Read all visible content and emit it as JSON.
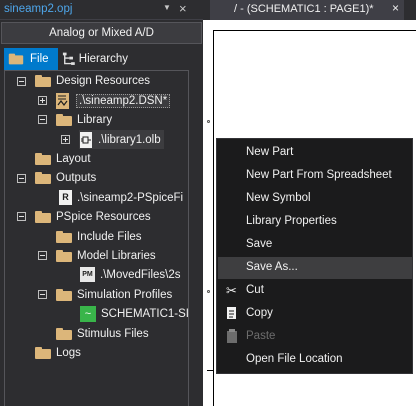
{
  "project_panel": {
    "title": "sineamp2.opj",
    "pin_glyph": "▼",
    "close_glyph": "×",
    "mode_label": "Analog or Mixed A/D",
    "tabs": [
      {
        "label": "File",
        "active": true
      },
      {
        "label": "Hierarchy",
        "active": false
      }
    ],
    "tree": {
      "design_resources": "Design Resources",
      "dsn_file": ".\\sineamp2.DSN*",
      "library": "Library",
      "library_file": ".\\library1.olb",
      "layout": "Layout",
      "outputs": "Outputs",
      "outputs_file": ".\\sineamp2-PSpiceFi",
      "pspice_resources": "PSpice Resources",
      "include_files": "Include Files",
      "model_libraries": "Model Libraries",
      "model_file": ".\\MovedFiles\\2s",
      "simulation_profiles": "Simulation Profiles",
      "sim_profile": "SCHEMATIC1-SI",
      "stimulus_files": "Stimulus Files",
      "logs": "Logs"
    },
    "badges": {
      "r": "R",
      "pm": "PM"
    }
  },
  "document": {
    "tab_title": "/ - (SCHEMATIC1 : PAGE1)*",
    "tab_close": "×"
  },
  "context_menu": {
    "items": [
      {
        "label": "New Part"
      },
      {
        "label": "New Part From Spreadsheet"
      },
      {
        "label": "New Symbol"
      },
      {
        "label": "Library Properties"
      },
      {
        "label": "Save"
      },
      {
        "label": "Save As..."
      },
      {
        "label": "Cut"
      },
      {
        "label": "Copy"
      },
      {
        "label": "Paste"
      },
      {
        "label": "Open File Location"
      }
    ]
  },
  "colors": {
    "accent": "#007acc",
    "title_blue": "#4ea6ea",
    "folder": "#dcb67a",
    "panel_bg": "#2d2d30",
    "menu_bg": "#1b1b1c"
  }
}
